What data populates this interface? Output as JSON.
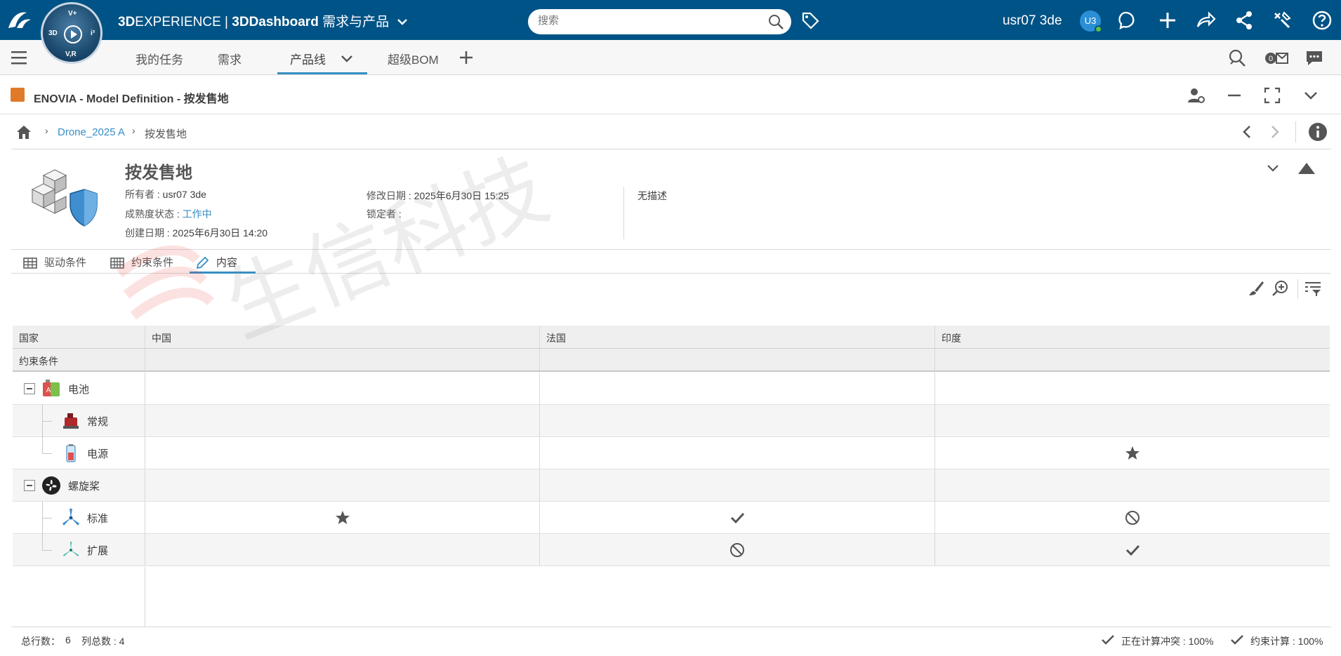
{
  "topbar": {
    "brand_bold": "3D",
    "brand_rest": "EXPERIENCE | ",
    "brand_dash": "3DDashboard",
    "brand_app": " 需求与产品",
    "compass_top": "V+",
    "compass_left": "3D",
    "compass_right": "i³",
    "compass_bottom": "V,R",
    "search_placeholder": "搜索",
    "username": "usr07 3de",
    "avatar_initials": "U3"
  },
  "tabs": {
    "items": [
      {
        "label": "我的任务"
      },
      {
        "label": "需求"
      },
      {
        "label": "产品线"
      },
      {
        "label": "超级BOM"
      }
    ]
  },
  "widget": {
    "title": "ENOVIA - Model Definition - 按发售地"
  },
  "breadcrumb": {
    "parent": "Drone_2025 A",
    "current": "按发售地"
  },
  "object": {
    "title": "按发售地",
    "owner_label": "所有者",
    "owner_value": "usr07 3de",
    "maturity_label": "成熟度状态",
    "maturity_value": "工作中",
    "created_label": "创建日期",
    "created_value": "2025年6月30日 14:20",
    "modified_label": "修改日期",
    "modified_value": "2025年6月30日 15:25",
    "locker_label": "锁定者",
    "locker_value": "",
    "description": "无描述"
  },
  "subtabs": {
    "items": [
      {
        "label": "驱动条件"
      },
      {
        "label": "约束条件"
      },
      {
        "label": "内容"
      }
    ]
  },
  "grid": {
    "row_header_1": "国家",
    "row_header_2": "约束条件",
    "columns": [
      "中国",
      "法国",
      "印度"
    ],
    "rows": [
      {
        "label": "电池",
        "level": 0,
        "cells": [
          "",
          "",
          ""
        ]
      },
      {
        "label": "常规",
        "level": 1,
        "cells": [
          "",
          "",
          ""
        ]
      },
      {
        "label": "电源",
        "level": 1,
        "cells": [
          "",
          "",
          "star"
        ]
      },
      {
        "label": "螺旋桨",
        "level": 0,
        "cells": [
          "",
          "",
          ""
        ]
      },
      {
        "label": "标准",
        "level": 1,
        "cells": [
          "star",
          "check",
          "forbidden"
        ]
      },
      {
        "label": "扩展",
        "level": 1,
        "cells": [
          "",
          "forbidden",
          "check"
        ]
      }
    ]
  },
  "footer": {
    "total_rows_label": "总行数：",
    "total_rows_value": "6",
    "total_cols_label": "列总数 : 4",
    "conflict_status": "正在计算冲突 : 100%",
    "constraint_status": "约束计算 : 100%"
  },
  "watermark": {
    "text": "生信科技"
  },
  "colors": {
    "topbar": "#005386",
    "accent": "#368ec4",
    "app_icon": "#e07a2b"
  }
}
